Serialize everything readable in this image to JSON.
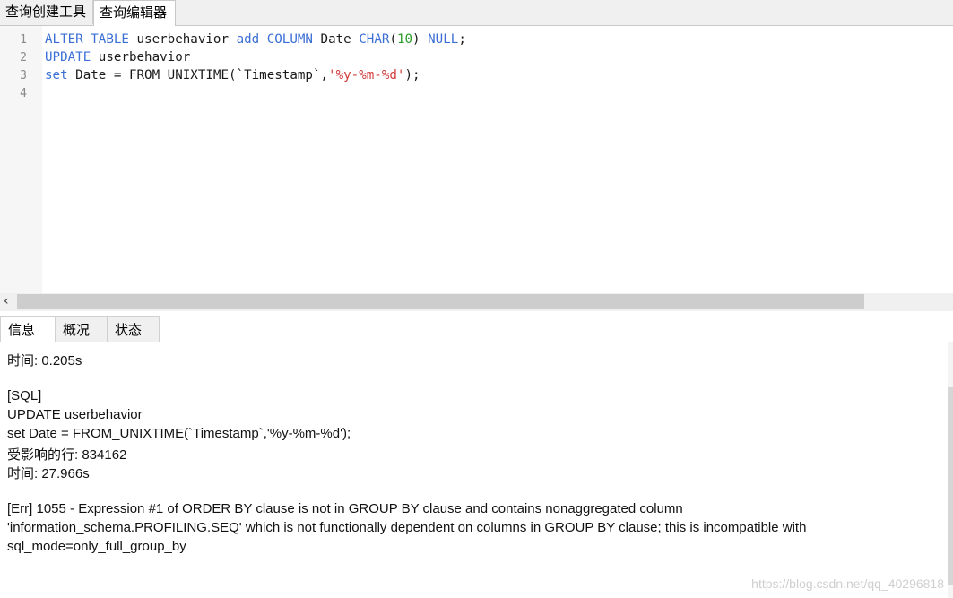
{
  "tabs": [
    {
      "label": "查询创建工具",
      "active": false
    },
    {
      "label": "查询编辑器",
      "active": true
    }
  ],
  "editor": {
    "line_numbers": [
      "1",
      "2",
      "3",
      "4"
    ],
    "lines": [
      [
        {
          "t": "ALTER TABLE",
          "c": "kw"
        },
        {
          "t": " userbehavior ",
          "c": "plain"
        },
        {
          "t": "add COLUMN",
          "c": "kw"
        },
        {
          "t": " Date ",
          "c": "plain"
        },
        {
          "t": "CHAR",
          "c": "kw"
        },
        {
          "t": "(",
          "c": "plain"
        },
        {
          "t": "10",
          "c": "num"
        },
        {
          "t": ") ",
          "c": "plain"
        },
        {
          "t": "NULL",
          "c": "kw"
        },
        {
          "t": ";",
          "c": "plain"
        }
      ],
      [
        {
          "t": "UPDATE",
          "c": "kw"
        },
        {
          "t": " userbehavior",
          "c": "plain"
        }
      ],
      [
        {
          "t": "set",
          "c": "kw"
        },
        {
          "t": " Date = FROM_UNIXTIME(`Timestamp`,",
          "c": "plain"
        },
        {
          "t": "'%y-%m-%d'",
          "c": "str"
        },
        {
          "t": ");",
          "c": "plain"
        }
      ],
      []
    ]
  },
  "colors": {
    "keyword": "#3b6fd6",
    "number": "#2a9d2a",
    "string": "#d23c3c"
  },
  "result_tabs": [
    {
      "label": "信息",
      "active": true
    },
    {
      "label": "概况",
      "active": false
    },
    {
      "label": "状态",
      "active": false
    }
  ],
  "result_lines": [
    "时间: 0.205s",
    "",
    "[SQL]",
    "UPDATE userbehavior",
    "set Date = FROM_UNIXTIME(`Timestamp`,'%y-%m-%d');",
    "受影响的行: 834162",
    "时间: 27.966s",
    "",
    "[Err] 1055 - Expression #1 of ORDER BY clause is not in GROUP BY clause and contains nonaggregated column",
    "'information_schema.PROFILING.SEQ' which is not functionally dependent on columns in GROUP BY clause; this is incompatible with",
    "sql_mode=only_full_group_by"
  ],
  "watermark": "https://blog.csdn.net/qq_40296818"
}
